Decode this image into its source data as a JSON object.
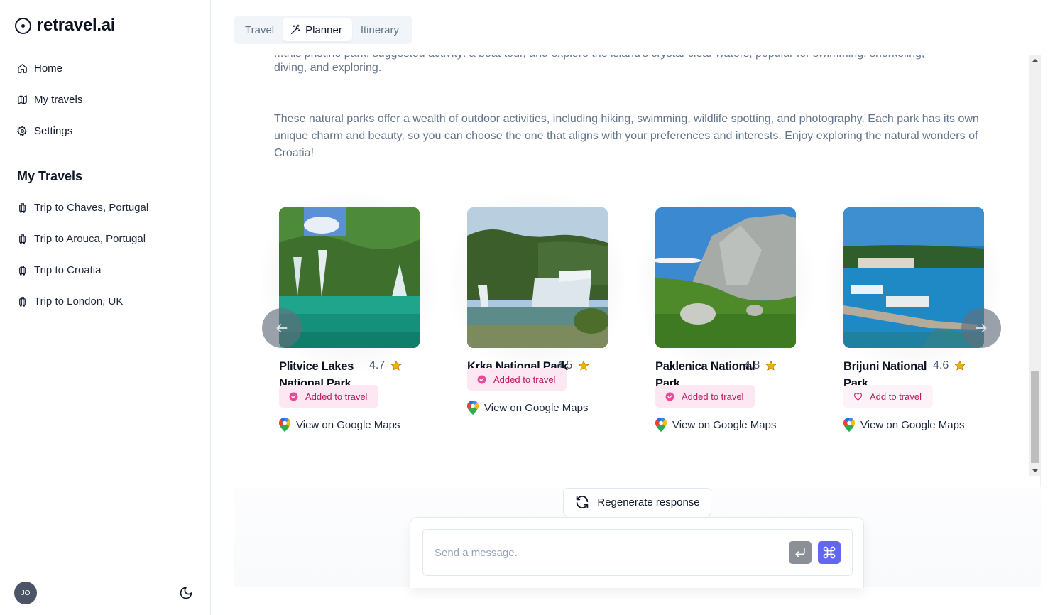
{
  "app": {
    "name": "retravel.ai"
  },
  "sidebar": {
    "nav": [
      {
        "label": "Home",
        "icon": "home-icon"
      },
      {
        "label": "My travels",
        "icon": "map-icon"
      },
      {
        "label": "Settings",
        "icon": "gear-icon"
      }
    ],
    "section_title": "My Travels",
    "trips": [
      {
        "label": "Trip to Chaves, Portugal",
        "icon": "luggage-icon"
      },
      {
        "label": "Trip to Arouca, Portugal",
        "icon": "luggage-icon"
      },
      {
        "label": "Trip to Croatia",
        "icon": "luggage-icon"
      },
      {
        "label": "Trip to London, UK",
        "icon": "luggage-icon"
      }
    ],
    "user_initials": "JO"
  },
  "tabs": [
    {
      "label": "Travel",
      "active": false
    },
    {
      "label": "Planner",
      "active": true,
      "icon": "magic-wand-icon"
    },
    {
      "label": "Itinerary",
      "active": false
    }
  ],
  "chat": {
    "partial_line": "...this pristine park, suggested activity: a boat tour, and explore the island's crystal-clear waters, popular for swimming, snorkeling,",
    "partial_line_end": "diving, and exploring.",
    "paragraph": "These natural parks offer a wealth of outdoor activities, including hiking, swimming, wildlife spotting, and photography. Each park has its own unique charm and beauty, so you can choose the one that aligns with your preferences and interests. Enjoy exploring the natural wonders of Croatia!"
  },
  "places": [
    {
      "name": "Plitvice Lakes National Park",
      "rating": "4.7",
      "status": "Added to travel",
      "added": true,
      "maps_label": "View on Google Maps"
    },
    {
      "name": "Krka National Park",
      "rating": "4.5",
      "status": "Added to travel",
      "added": true,
      "maps_label": "View on Google Maps"
    },
    {
      "name": "Paklenica National Park",
      "rating": "4.8",
      "status": "Added to travel",
      "added": true,
      "maps_label": "View on Google Maps"
    },
    {
      "name": "Brijuni National Park",
      "rating": "4.6",
      "status": "Add to travel",
      "added": false,
      "maps_label": "View on Google Maps"
    }
  ],
  "actions": {
    "regenerate_label": "Regenerate response",
    "message_placeholder": "Send a message.",
    "message_value": ""
  },
  "colors": {
    "accent_pink": "#be185d",
    "badge_bg": "#fce7f3",
    "star": "#eab308",
    "cmd_button": "#6366f1"
  }
}
